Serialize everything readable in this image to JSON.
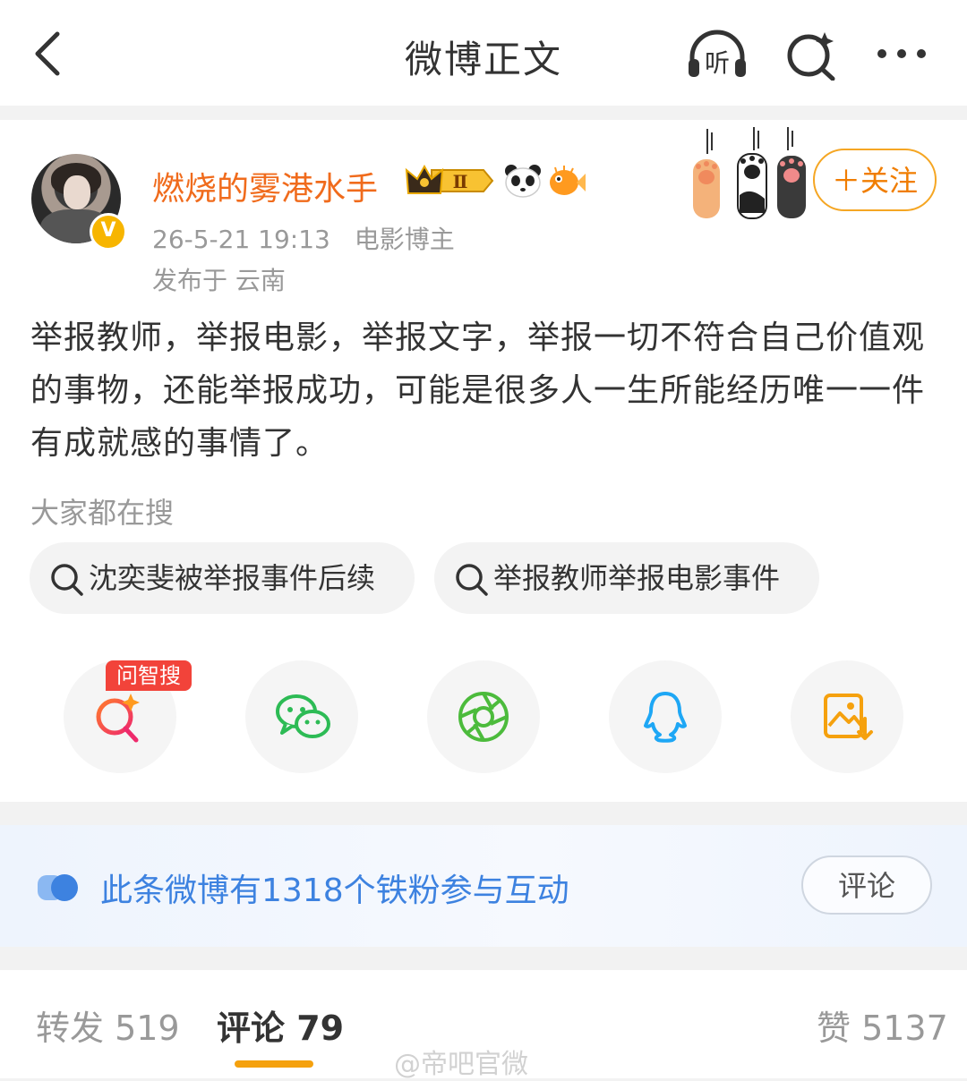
{
  "nav": {
    "title": "微博正文",
    "listen_label": "听"
  },
  "post": {
    "username": "燃烧的雾港水手",
    "level_badge": "Ⅱ",
    "timestamp": "26-5-21 19:13",
    "role": "电影博主",
    "location": "发布于 云南",
    "follow_label": "＋关注",
    "text": "举报教师，举报电影，举报文字，举报一切不符合自己价值观的事物，还能举报成功，可能是很多人一生所能经历唯一一件有成就感的事情了。",
    "verified_mark": "V"
  },
  "search": {
    "label": "大家都在搜",
    "chips": [
      "沈奕斐被举报事件后续",
      "举报教师举报电影事件"
    ]
  },
  "share": {
    "ai_tag": "问智搜",
    "items": [
      "ai-search-icon",
      "wechat-icon",
      "moments-icon",
      "qq-icon",
      "save-image-icon"
    ]
  },
  "fans": {
    "text": "此条微博有1318个铁粉参与互动",
    "button_label": "评论"
  },
  "tabs": {
    "repost": "转发 519",
    "comment": "评论 79",
    "like": "赞 5137"
  },
  "watermark": "@帝吧官微",
  "colors": {
    "accent": "#f5a10e",
    "username": "#f06b1c",
    "link_blue": "#3d82e0",
    "tag_red": "#f2433a"
  }
}
